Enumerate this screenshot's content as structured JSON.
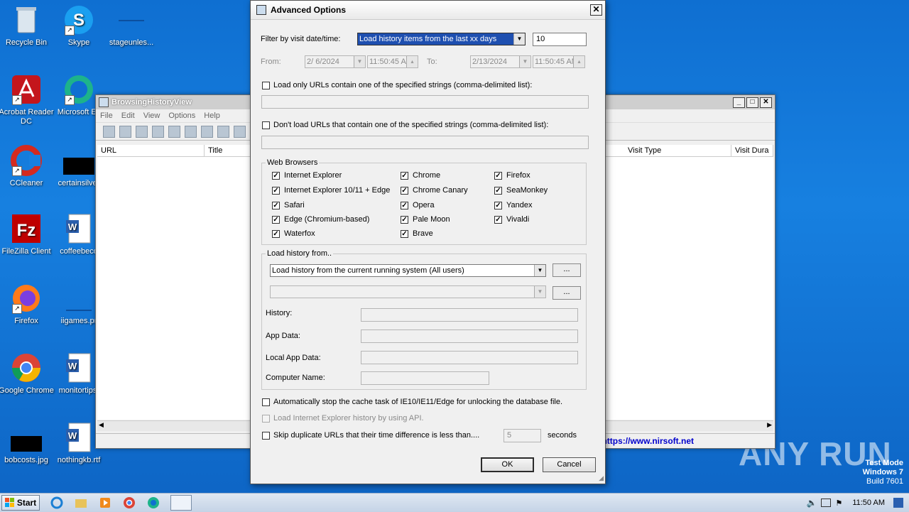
{
  "desktop": {
    "icons": [
      {
        "label": "Recycle Bin"
      },
      {
        "label": "Skype"
      },
      {
        "label": "stageunles..."
      },
      {
        "label": "Acrobat Reader DC"
      },
      {
        "label": "Microsoft Ec"
      },
      {
        "label": "CCleaner"
      },
      {
        "label": "certainsilver"
      },
      {
        "label": "FileZilla Client"
      },
      {
        "label": "coffeebeco"
      },
      {
        "label": "Firefox"
      },
      {
        "label": "iigames.pr"
      },
      {
        "label": "Google Chrome"
      },
      {
        "label": "monitortips."
      },
      {
        "label": "bobcosts.jpg"
      },
      {
        "label": "nothingkb.rtf"
      }
    ]
  },
  "app_window": {
    "title": "BrowsingHistoryView",
    "menu": [
      "File",
      "Edit",
      "View",
      "Options",
      "Help"
    ],
    "columns": [
      "URL",
      "Title",
      "Visit Type",
      "Visit Dura"
    ],
    "status_link": "https://www.nirsoft.net"
  },
  "dialog": {
    "title": "Advanced Options",
    "filter_label": "Filter by visit date/time:",
    "filter_value": "Load history items from the last xx days",
    "days_value": "10",
    "from_label": "From:",
    "from_date": "2/  6/2024",
    "from_time": "11:50:45 AM",
    "to_label": "To:",
    "to_date": "2/13/2024",
    "to_time": "11:50:45 AM",
    "load_only_label": "Load only URLs contain one of the specified strings (comma-delimited list):",
    "dont_load_label": "Don't load URLs that contain one of the specified strings (comma-delimited list):",
    "web_browsers_label": "Web Browsers",
    "browsers_col1": [
      "Internet Explorer",
      "Internet Explorer 10/11 + Edge",
      "Safari",
      "Edge (Chromium-based)",
      "Waterfox"
    ],
    "browsers_col2": [
      "Chrome",
      "Chrome Canary",
      "Opera",
      "Pale Moon",
      "Brave"
    ],
    "browsers_col3": [
      "Firefox",
      "SeaMonkey",
      "Yandex",
      "Vivaldi"
    ],
    "load_from_label": "Load history from..",
    "load_from_value": "Load history from the current running system (All users)",
    "browse_label": "...",
    "history_label": "History:",
    "appdata_label": "App Data:",
    "localappdata_label": "Local App Data:",
    "computername_label": "Computer Name:",
    "auto_stop_label": "Automatically stop the cache task of IE10/IE11/Edge for unlocking the database file.",
    "ie_api_label": "Load Internet Explorer history by using API.",
    "skip_dup_label": "Skip duplicate URLs that their time difference is less than....",
    "skip_value": "5",
    "seconds_label": "seconds",
    "ok_label": "OK",
    "cancel_label": "Cancel"
  },
  "taskbar": {
    "start_label": "Start",
    "clock": "11:50 AM"
  },
  "watermark": {
    "line1": "Test Mode",
    "line2": "Windows 7",
    "line3": "Build 7601",
    "brand": "ANY RUN"
  }
}
